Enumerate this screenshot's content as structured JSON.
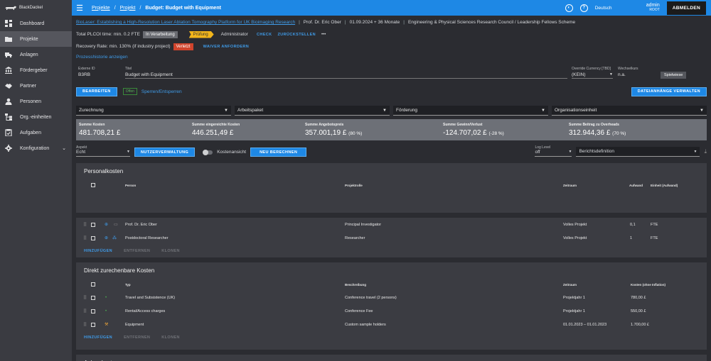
{
  "app": {
    "name": "BlackDackel"
  },
  "sidebar": {
    "items": [
      {
        "label": "Dashboard",
        "icon": "dashboard-icon"
      },
      {
        "label": "Projekte",
        "icon": "folder-icon",
        "active": true
      },
      {
        "label": "Anlagen",
        "icon": "truck-icon"
      },
      {
        "label": "Fördergeber",
        "icon": "bank-icon"
      },
      {
        "label": "Partner",
        "icon": "handshake-icon"
      },
      {
        "label": "Personen",
        "icon": "person-icon"
      },
      {
        "label": "Org.-einheiten",
        "icon": "org-icon"
      },
      {
        "label": "Aufgaben",
        "icon": "tasks-icon"
      },
      {
        "label": "Konfiguration",
        "icon": "gear-icon"
      }
    ]
  },
  "topbar": {
    "breadcrumbs": [
      "Projekte",
      "Projekt",
      "Budget: Budget with Equipment"
    ],
    "language": "Deutsch",
    "user_name": "admin",
    "user_role": "ROOT",
    "logout_label": "ABMELDEN"
  },
  "project": {
    "title": "BioLaser: Establishing a High-Resolution Laser Ablation Tomography Platform for UK Bioimaging Research",
    "pi": "Prof. Dr. Eric Ober",
    "period": "01.09.2024 + 36 Monate",
    "funder": "Engineering & Physical Sciences Research Council / Leadership Fellows Scheme"
  },
  "status": {
    "plcoi": "Total PLCOI time: min. 0.2 FTE",
    "state": "In Verarbeitung",
    "stage": "Prüfung",
    "role": "Administrator",
    "check": "CHECK",
    "reset": "ZURÜCKSTELLEN",
    "more": "•••",
    "recovery": "Recovery Rate: min. 130% (if industry project)",
    "recovery_state": "Verletzt",
    "waiver": "WAIVER ANFORDERN",
    "history": "Prozesshistorie anzeigen"
  },
  "form": {
    "external_id_label": "Externe ID",
    "external_id": "B3RB",
    "title_label": "Titel",
    "title": "Budget with Equipment",
    "currency_label": "Override Currency [TBD]",
    "currency": "(KEIN)",
    "wechselkurs_label": "Wechselkurs",
    "wechselkurs": "n.a.",
    "spielwiese": "Spielwiese"
  },
  "actions": {
    "edit": "BEARBEITEN",
    "open_badge": "Offen",
    "lock": "Sperren/Entsperren",
    "attachments": "DATEIANHÄNGE VERWALTEN"
  },
  "filters": [
    "Zurechnung",
    "Arbeitspaket",
    "Förderung",
    "Organisationseinheit"
  ],
  "sums": [
    {
      "label": "Summe Kosten",
      "value": "481.708,21 £",
      "extra": ""
    },
    {
      "label": "Summe eingereichte Kosten",
      "value": "446.251,49 £",
      "extra": ""
    },
    {
      "label": "Summe Angebotspreis",
      "value": "357.001,19 £",
      "extra": "(80 %)"
    },
    {
      "label": "Summe Gewinn/Verlust",
      "value": "-124.707,02 £",
      "extra": "(-28 %)"
    },
    {
      "label": "Summe Beitrag zu Overheads",
      "value": "312.944,36 £",
      "extra": "(70 %)"
    }
  ],
  "controls": {
    "aspekt_label": "Aspekt",
    "aspekt": "Echt",
    "user_mgmt": "NUTZERVERWALTUNG",
    "cost_view": "Kostenansicht",
    "recalc": "NEU BERECHNEN",
    "log_label": "Log Level",
    "log": "off",
    "report": "Berichtsdefinition"
  },
  "personal": {
    "title": "Personalkosten",
    "headers": [
      "Person",
      "Projektrolle",
      "Zeitraum",
      "Aufwand",
      "Einheit (Aufwand)"
    ],
    "rows": [
      {
        "person": "Prof. Dr. Eric Ober",
        "role": "Principal Investigator",
        "period": "Volles Projekt",
        "effort": "0,1",
        "unit": "FTE"
      },
      {
        "person": "Postdoctoral Researcher",
        "role": "Researcher",
        "period": "Volles Projekt",
        "effort": "1",
        "unit": "FTE"
      }
    ]
  },
  "direct": {
    "title": "Direkt zurechenbare Kosten",
    "headers": [
      "Typ",
      "Beschreibung",
      "Zeitraum",
      "Kosten (ohne Inflation)"
    ],
    "rows": [
      {
        "type": "Travel and Subsistence (UK)",
        "desc": "Conference travel (2 persons)",
        "period": "Projektjahr 1",
        "cost": "780,00 £"
      },
      {
        "type": "Rental/Access charges",
        "desc": "Conference Fee",
        "period": "Projektjahr 1",
        "cost": "550,00 £"
      },
      {
        "type": "Equipment",
        "desc": "Custom sample holders",
        "period": "01.01.2023 – 01.01.2023",
        "cost": "1.700,00 £"
      }
    ]
  },
  "table_actions": {
    "add": "HINZUFÜGEN",
    "remove": "ENTFERNEN",
    "clone": "KLONEN"
  },
  "assets": {
    "title": "Anlagekosten"
  }
}
